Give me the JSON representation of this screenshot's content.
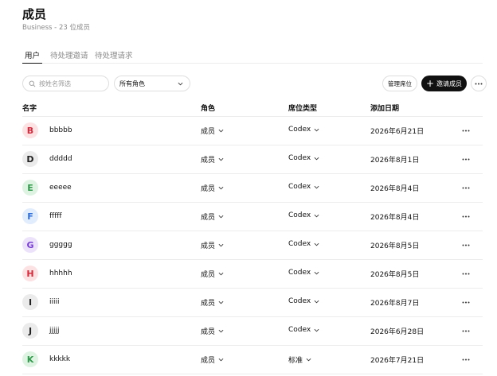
{
  "header": {
    "title": "成员",
    "subtitle": "Business - 23 位成员"
  },
  "tabs": [
    {
      "label": "用户",
      "active": true
    },
    {
      "label": "待处理邀请",
      "active": false
    },
    {
      "label": "待处理请求",
      "active": false
    }
  ],
  "toolbar": {
    "search_placeholder": "按姓名筛选",
    "search_icon": "search-icon",
    "role_filter": "所有角色",
    "manage_seats": "管理席位",
    "invite": "邀请成员",
    "more_icon": "more-horizontal-icon"
  },
  "table": {
    "headers": {
      "name": "名字",
      "role": "角色",
      "seat": "席位类型",
      "date": "添加日期"
    },
    "rows": [
      {
        "initial": "B",
        "name": "bbbbb",
        "role": "成员",
        "seat": "Codex",
        "date": "2026年6月21日",
        "bg": "#fde2e4",
        "fg": "#d6293c"
      },
      {
        "initial": "D",
        "name": "ddddd",
        "role": "成员",
        "seat": "Codex",
        "date": "2026年8月1日",
        "bg": "#ebebeb",
        "fg": "#222222"
      },
      {
        "initial": "E",
        "name": "eeeee",
        "role": "成员",
        "seat": "Codex",
        "date": "2026年8月4日",
        "bg": "#dff3e3",
        "fg": "#2f9a4a"
      },
      {
        "initial": "F",
        "name": "fffff",
        "role": "成员",
        "seat": "Codex",
        "date": "2026年8月4日",
        "bg": "#e1ecfd",
        "fg": "#2f6fde"
      },
      {
        "initial": "G",
        "name": "ggggg",
        "role": "成员",
        "seat": "Codex",
        "date": "2026年8月5日",
        "bg": "#ece3fb",
        "fg": "#7a3fd4"
      },
      {
        "initial": "H",
        "name": "hhhhh",
        "role": "成员",
        "seat": "Codex",
        "date": "2026年8月5日",
        "bg": "#fde2e4",
        "fg": "#d6293c"
      },
      {
        "initial": "I",
        "name": "iiiii",
        "role": "成员",
        "seat": "Codex",
        "date": "2026年8月7日",
        "bg": "#ebebeb",
        "fg": "#222222"
      },
      {
        "initial": "J",
        "name": "jjjjj",
        "role": "成员",
        "seat": "Codex",
        "date": "2026年6月28日",
        "bg": "#ebebeb",
        "fg": "#222222"
      },
      {
        "initial": "K",
        "name": "kkkkk",
        "role": "成员",
        "seat": "标准",
        "date": "2026年7月21日",
        "bg": "#dff3e3",
        "fg": "#2f9a4a"
      }
    ]
  }
}
